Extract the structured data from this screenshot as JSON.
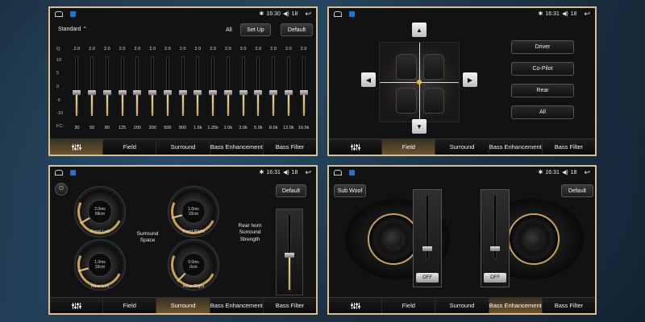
{
  "status": {
    "time_eq": "16:30",
    "time_field": "16:31",
    "time_surround": "16:31",
    "time_bass": "16:31",
    "volume": "18"
  },
  "tabs": {
    "field": "Field",
    "surround": "Surround",
    "bass_enhancement": "Bass Enhancement",
    "bass_filter": "Bass Filter"
  },
  "eq": {
    "preset": "Standard",
    "all": "All",
    "setup": "Set Up",
    "default": "Default",
    "q_label": "Q:",
    "fc_label": "FC:",
    "axis": [
      "10",
      "5",
      "0",
      "-5",
      "-10"
    ],
    "q_values": [
      "2.0",
      "2.0",
      "2.0",
      "2.0",
      "2.0",
      "2.0",
      "2.0",
      "2.0",
      "2.0",
      "2.0",
      "2.0",
      "2.0",
      "2.0",
      "2.0",
      "2.0",
      "2.0"
    ],
    "fc_values": [
      "30",
      "50",
      "80",
      "125",
      "200",
      "300",
      "500",
      "800",
      "1.6k",
      "1.25k",
      "2.0k",
      "3.0k",
      "5.0k",
      "8.0k",
      "12.0k",
      "16.0k"
    ]
  },
  "field": {
    "driver": "Driver",
    "copilot": "Co-Pilot",
    "rear": "Rear",
    "all": "All"
  },
  "surround": {
    "default": "Default",
    "front_left": "Front Left",
    "front_right": "Front Right",
    "rear_left": "Rear Left",
    "rear_right": "Rear Right",
    "fl_ms": "2.0ms",
    "fl_cm": "68cm",
    "fr_ms": "1.0ms",
    "fr_cm": "33cm",
    "rl_ms": "1.0ms",
    "rl_cm": "33cm",
    "rr_ms": "0.0ms",
    "rr_cm": "0cm",
    "space": "Surround Space",
    "strength": "Rear horn Surround Strength"
  },
  "bass": {
    "subwoof": "Sub Woof",
    "default": "Default",
    "off": "OFF"
  }
}
